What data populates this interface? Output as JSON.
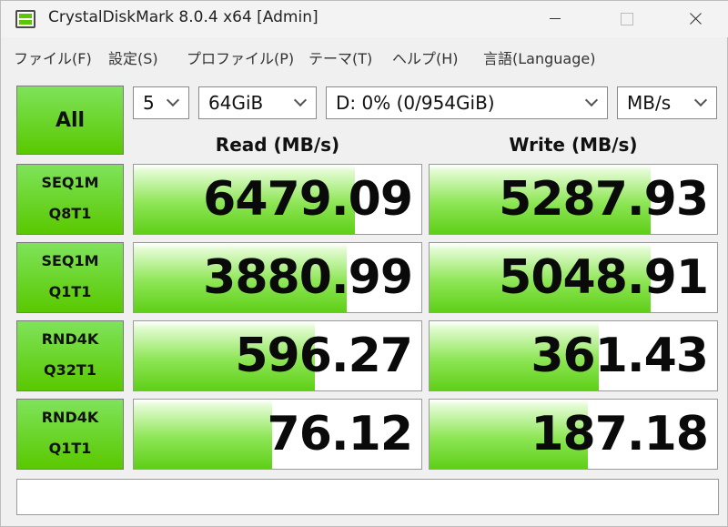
{
  "window": {
    "title": "CrystalDiskMark 8.0.4 x64 [Admin]"
  },
  "menu": [
    "ファイル(F)",
    "設定(S)",
    "プロファイル(P)",
    "テーマ(T)",
    "ヘルプ(H)",
    "言語(Language)"
  ],
  "controls": {
    "all_label": "All",
    "count": "5",
    "size": "64GiB",
    "drive": "D: 0% (0/954GiB)",
    "unit": "MB/s"
  },
  "headers": {
    "read": "Read (MB/s)",
    "write": "Write (MB/s)"
  },
  "rows": [
    {
      "label1": "SEQ1M",
      "label2": "Q8T1",
      "read": "6479.09",
      "write": "5287.93",
      "read_fill": 0.77,
      "write_fill": 0.77
    },
    {
      "label1": "SEQ1M",
      "label2": "Q1T1",
      "read": "3880.99",
      "write": "5048.91",
      "read_fill": 0.74,
      "write_fill": 0.77
    },
    {
      "label1": "RND4K",
      "label2": "Q32T1",
      "read": "596.27",
      "write": "361.43",
      "read_fill": 0.63,
      "write_fill": 0.59
    },
    {
      "label1": "RND4K",
      "label2": "Q1T1",
      "read": "76.12",
      "write": "187.18",
      "read_fill": 0.48,
      "write_fill": 0.55
    }
  ],
  "comment": "",
  "colors": {
    "accent_green": "#5ac800",
    "bar_green": "#8ee656"
  }
}
